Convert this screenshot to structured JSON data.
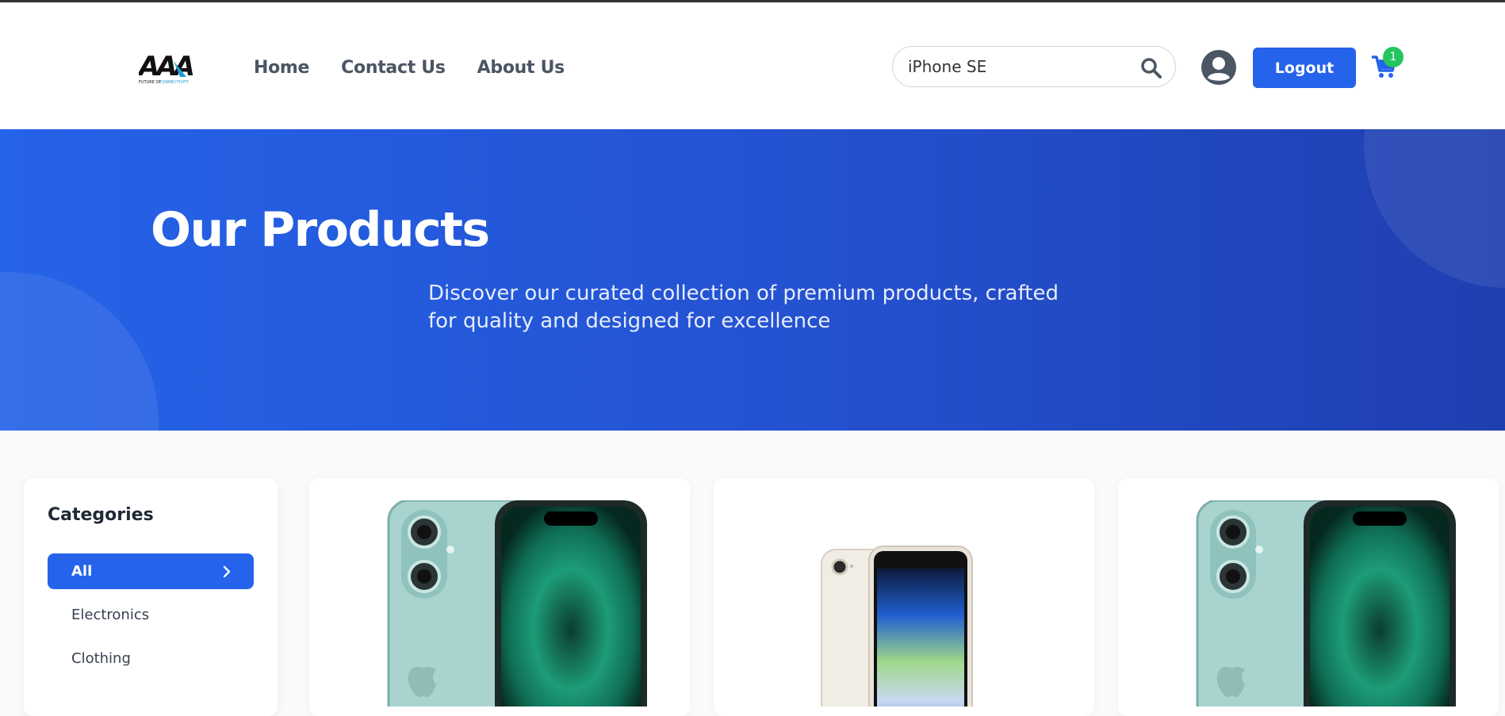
{
  "brand": {
    "logo_text": "AAA",
    "logo_tagline": "FUTURE OF CONNECTIVITY"
  },
  "nav": {
    "home": "Home",
    "contact": "Contact Us",
    "about": "About Us"
  },
  "search": {
    "value": "iPhone SE"
  },
  "header": {
    "logout_label": "Logout",
    "cart_count": "1"
  },
  "hero": {
    "title": "Our Products",
    "subtitle": "Discover our curated collection of premium products, crafted for quality and designed for excellence"
  },
  "sidebar": {
    "title": "Categories",
    "items": [
      {
        "label": "All",
        "active": true
      },
      {
        "label": "Electronics",
        "active": false
      },
      {
        "label": "Clothing",
        "active": false
      }
    ]
  },
  "products": [
    {
      "image": "iphone-16-teal"
    },
    {
      "image": "iphone-se-starlight"
    },
    {
      "image": "iphone-16-teal"
    }
  ],
  "colors": {
    "primary": "#2563eb",
    "badge": "#22c55e",
    "nav_text": "#4b5563"
  }
}
